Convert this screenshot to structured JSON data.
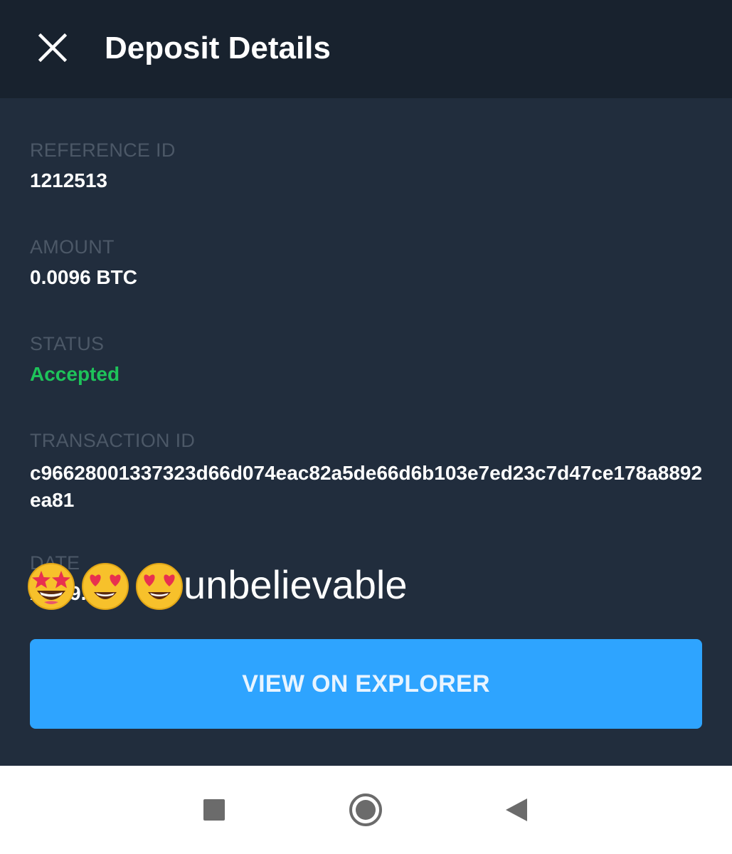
{
  "header": {
    "title": "Deposit Details",
    "close_icon": "close-icon"
  },
  "details": {
    "reference": {
      "label": "REFERENCE ID",
      "value": "1212513"
    },
    "amount": {
      "label": "AMOUNT",
      "value": "0.0096 BTC"
    },
    "status": {
      "label": "STATUS",
      "value": "Accepted",
      "color": "#1ec35a"
    },
    "transaction": {
      "label": "TRANSACTION ID",
      "value": "c96628001337323d66d074eac82a5de66d6b103e7ed23c7d47ce178a8892ea81"
    },
    "date": {
      "label_partial": "DATE",
      "value_partial": "Apr  9.   PM"
    }
  },
  "overlay": {
    "emojis": [
      "star-struck-emoji",
      "heart-eyes-emoji",
      "heart-eyes-emoji"
    ],
    "text": "unbelievable"
  },
  "actions": {
    "explorer_label": "VIEW ON EXPLORER",
    "explorer_color": "#2ea4ff"
  },
  "nav": {
    "icons": [
      "recents-square-icon",
      "home-circle-icon",
      "back-triangle-icon"
    ]
  },
  "colors": {
    "header_bg": "#18222e",
    "content_bg": "#212d3d",
    "label": "#4c5867"
  }
}
